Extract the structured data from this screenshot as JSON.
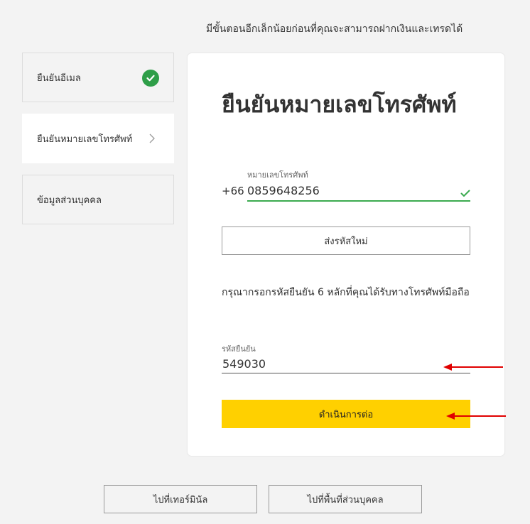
{
  "top_note": "มีขั้นตอนอีกเล็กน้อยก่อนที่คุณจะสามารถฝากเงินและเทรดได้",
  "steps": [
    {
      "label": "ยืนยันอีเมล",
      "status": "completed"
    },
    {
      "label": "ยืนยันหมายเลขโทรศัพท์",
      "status": "active"
    },
    {
      "label": "ข้อมูลส่วนบุคคล",
      "status": "pending"
    }
  ],
  "card": {
    "title": "ยืนยันหมายเลขโทรศัพท์",
    "phone": {
      "label": "หมายเลขโทรศัพท์",
      "country_code": "+66",
      "value": "0859648256",
      "valid": true
    },
    "resend_button": "ส่งรหัสใหม่",
    "instruction": "กรุณากรอกรหัสยืนยัน 6 หลักที่คุณได้รับทางโทรศัพท์มือถือ",
    "code": {
      "label": "รหัสยืนยัน",
      "value": "549030"
    },
    "continue_button": "ดำเนินการต่อ"
  },
  "bottom_buttons": {
    "terminal": "ไปที่เทอร์มินัล",
    "personal_area": "ไปที่พื้นที่ส่วนบุคคล"
  },
  "colors": {
    "accent_yellow": "#ffd000",
    "success_green": "#2e9e48",
    "annotation_red": "#e00000"
  },
  "icons": [
    "check-circle-icon",
    "chevron-right-icon",
    "checkmark-icon",
    "red-arrow-annotation"
  ]
}
